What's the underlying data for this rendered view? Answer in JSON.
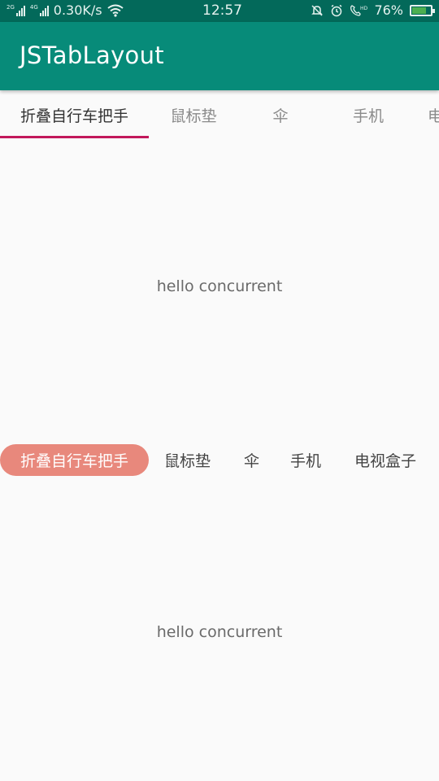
{
  "status_bar": {
    "signal1_label": "2G",
    "signal2_label": "4G",
    "speed": "0.30K/s",
    "time": "12:57",
    "battery_pct": "76%",
    "battery_level": 0.76,
    "icons": [
      "wifi-icon",
      "mute-bell-icon",
      "alarm-icon",
      "hd-call-icon",
      "battery-charging-icon"
    ]
  },
  "app_bar": {
    "title": "JSTabLayout"
  },
  "tabs_top": {
    "items": [
      "折叠自行车把手",
      "鼠标垫",
      "伞",
      "手机",
      "电"
    ],
    "active_index": 0,
    "indicator_color": "#c2185b"
  },
  "content_top": {
    "text": "hello concurrent"
  },
  "tabs_pill": {
    "items": [
      "折叠自行车把手",
      "鼠标垫",
      "伞",
      "手机",
      "电视盒子"
    ],
    "active_index": 0,
    "pill_color": "#e8887c"
  },
  "content_bottom": {
    "text": "hello concurrent"
  },
  "colors": {
    "status_bar": "#03695a",
    "app_bar": "#078b79",
    "background": "#fafafa"
  }
}
